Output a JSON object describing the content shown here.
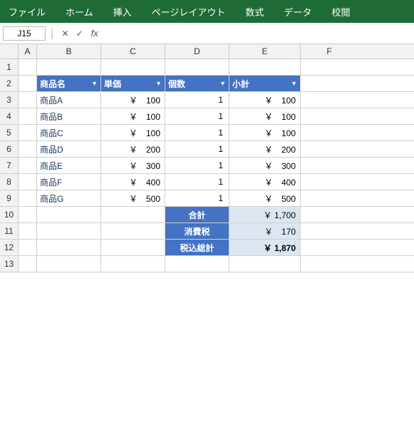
{
  "menubar": {
    "items": [
      "ファイル",
      "ホーム",
      "挿入",
      "ページレイアウト",
      "数式",
      "データ",
      "校閲"
    ]
  },
  "formula_bar": {
    "cell_ref": "J15",
    "cancel_icon": "✕",
    "confirm_icon": "✓",
    "fx_label": "fx"
  },
  "columns": {
    "headers": [
      "A",
      "B",
      "C",
      "D",
      "E",
      "F"
    ],
    "col_a_width": 26,
    "col_b_width": 90,
    "col_c_width": 90,
    "col_d_width": 90,
    "col_e_width": 100,
    "col_f_width": 80
  },
  "row_numbers": [
    "1",
    "2",
    "3",
    "4",
    "5",
    "6",
    "7",
    "8",
    "9",
    "10",
    "11",
    "12",
    "13"
  ],
  "table_headers": {
    "col_b": "商品名",
    "col_c": "単価",
    "col_d": "個数",
    "col_e": "小計"
  },
  "data_rows": [
    {
      "row": "3",
      "b": "商品A",
      "c": "￥　100",
      "d": "1",
      "e": "￥　100"
    },
    {
      "row": "4",
      "b": "商品B",
      "c": "￥　100",
      "d": "1",
      "e": "￥　100"
    },
    {
      "row": "5",
      "b": "商品C",
      "c": "￥　100",
      "d": "1",
      "e": "￥　100"
    },
    {
      "row": "6",
      "b": "商品D",
      "c": "￥　200",
      "d": "1",
      "e": "￥　200"
    },
    {
      "row": "7",
      "b": "商品E",
      "c": "￥　300",
      "d": "1",
      "e": "￥　300"
    },
    {
      "row": "8",
      "b": "商品F",
      "c": "￥　400",
      "d": "1",
      "e": "￥　400"
    },
    {
      "row": "9",
      "b": "商品G",
      "c": "￥　500",
      "d": "1",
      "e": "￥　500"
    }
  ],
  "summary": {
    "row10": {
      "label": "合計",
      "value": "￥ 1,700"
    },
    "row11": {
      "label": "消費税",
      "value": "￥　170"
    },
    "row12": {
      "label": "税込総計",
      "value": "￥ 1,870"
    }
  },
  "dropdown_arrow": "▼"
}
